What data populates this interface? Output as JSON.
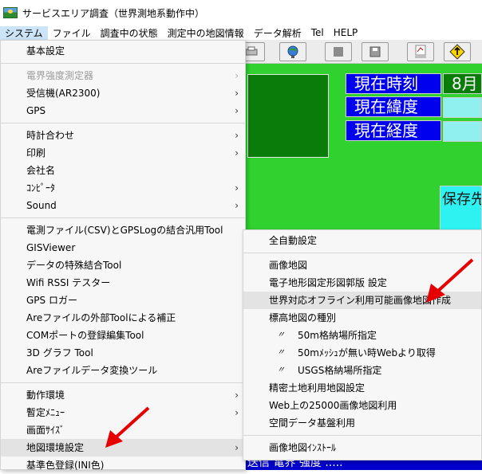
{
  "window": {
    "title": "サービスエリア調査（世界測地系動作中）"
  },
  "menubar": [
    {
      "label": "システム",
      "active": true
    },
    {
      "label": "ファイル"
    },
    {
      "label": "調査中の状態"
    },
    {
      "label": "測定中の地図情報"
    },
    {
      "label": "データ解析"
    },
    {
      "label": "Tel"
    },
    {
      "label": "HELP"
    }
  ],
  "background": {
    "labels": {
      "time": "現在時刻",
      "lat": "現在緯度",
      "lon": "現在経度",
      "month": "8月",
      "save": "保存先",
      "bottom": "送信 電界 強度 ....."
    }
  },
  "system_menu": {
    "items": [
      {
        "label": "基本設定"
      },
      {
        "sep": true
      },
      {
        "label": "電界強度測定器",
        "disabled": true,
        "submenu": true
      },
      {
        "label": "受信機(AR2300)",
        "submenu": true
      },
      {
        "label": "GPS",
        "submenu": true
      },
      {
        "sep": true
      },
      {
        "label": "時計合わせ",
        "submenu": true
      },
      {
        "label": "印刷",
        "submenu": true
      },
      {
        "label": "会社名"
      },
      {
        "label": "ｺﾝﾋﾟｰﾀ",
        "submenu": true
      },
      {
        "label": "Sound",
        "submenu": true
      },
      {
        "sep": true
      },
      {
        "label": "電測ファイル(CSV)とGPSLogの結合汎用Tool"
      },
      {
        "label": "GISViewer"
      },
      {
        "label": "データの特殊結合Tool"
      },
      {
        "label": "Wifi RSSI テスター"
      },
      {
        "label": "GPS ロガー"
      },
      {
        "label": "Areファイルの外部Toolによる補正"
      },
      {
        "label": "COMポートの登録編集Tool"
      },
      {
        "label": "3D グラフ Tool"
      },
      {
        "label": "Areファイルデータ変換ツール"
      },
      {
        "sep": true
      },
      {
        "label": "動作環境",
        "submenu": true
      },
      {
        "label": "暫定ﾒﾆｭｰ",
        "submenu": true
      },
      {
        "label": "画面ｻｲｽﾞ"
      },
      {
        "label": "地図環境設定",
        "submenu": true,
        "highlight": true
      },
      {
        "label": "基準色登録(INI色)"
      }
    ]
  },
  "map_submenu": {
    "items": [
      {
        "label": "全自動設定"
      },
      {
        "sep": true
      },
      {
        "label": "画像地図"
      },
      {
        "label": "電子地形図定形図郭版 設定"
      },
      {
        "label": "世界対応オフライン利用可能画像地図作成",
        "highlight": true
      },
      {
        "label": "標高地図の種別"
      },
      {
        "label": "50m格納場所指定",
        "indent": true,
        "mark": "〃"
      },
      {
        "label": "50mﾒｯｼｭが無い時Webより取得",
        "indent": true,
        "mark": "〃"
      },
      {
        "label": "USGS格納場所指定",
        "indent": true,
        "mark": "〃"
      },
      {
        "label": "精密土地利用地図設定"
      },
      {
        "label": "Web上の25000画像地図利用"
      },
      {
        "label": "空間データ基盤利用"
      },
      {
        "sep": true
      },
      {
        "label": "画像地図ｲﾝｽﾄｰﾙ"
      }
    ]
  },
  "colors": {
    "highlight": "#e3e3e3",
    "arrow_red": "#e60000",
    "bg_green": "#30d230",
    "label_blue": "#0000ee"
  }
}
